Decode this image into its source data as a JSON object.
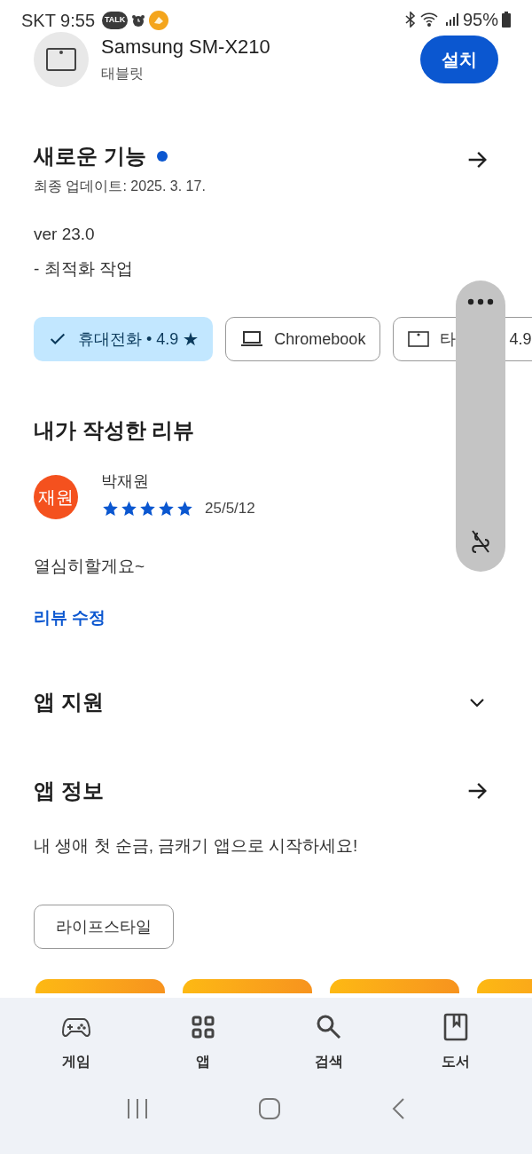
{
  "status_bar": {
    "carrier_time": "SKT 9:55",
    "talk_badge": "TALK",
    "battery": "95%"
  },
  "app_header": {
    "device": "Samsung SM-X210",
    "device_type": "태블릿",
    "install_button": "설치"
  },
  "whats_new": {
    "title": "새로운 기능",
    "new_dot": true,
    "updated": "최종 업데이트: 2025. 3. 17.",
    "lines": [
      "ver 23.0",
      "- 최적화 작업"
    ]
  },
  "device_chips": [
    {
      "kind": "check",
      "label": "휴대전화 • 4.9 ★",
      "selected": true
    },
    {
      "kind": "laptop",
      "label": "Chromebook",
      "selected": false
    },
    {
      "kind": "tablet",
      "label": "타",
      "label_tail": "4.9",
      "selected": false
    }
  ],
  "my_review": {
    "title": "내가 작성한 리뷰",
    "avatar": "재원",
    "name": "박재원",
    "stars": 5,
    "date": "25/5/12",
    "text": "열심히할게요~",
    "edit_link": "리뷰 수정"
  },
  "app_support": {
    "title": "앱 지원",
    "expanded": false
  },
  "app_info": {
    "title": "앱 정보",
    "description": "내 생애 첫 순금, 금캐기 앱으로 시작하세요!",
    "tag": "라이프스타일"
  },
  "bottom_nav": [
    {
      "kind": "games",
      "label": "게임"
    },
    {
      "kind": "apps",
      "label": "앱"
    },
    {
      "kind": "search",
      "label": "검색"
    },
    {
      "kind": "books",
      "label": "도서"
    }
  ]
}
